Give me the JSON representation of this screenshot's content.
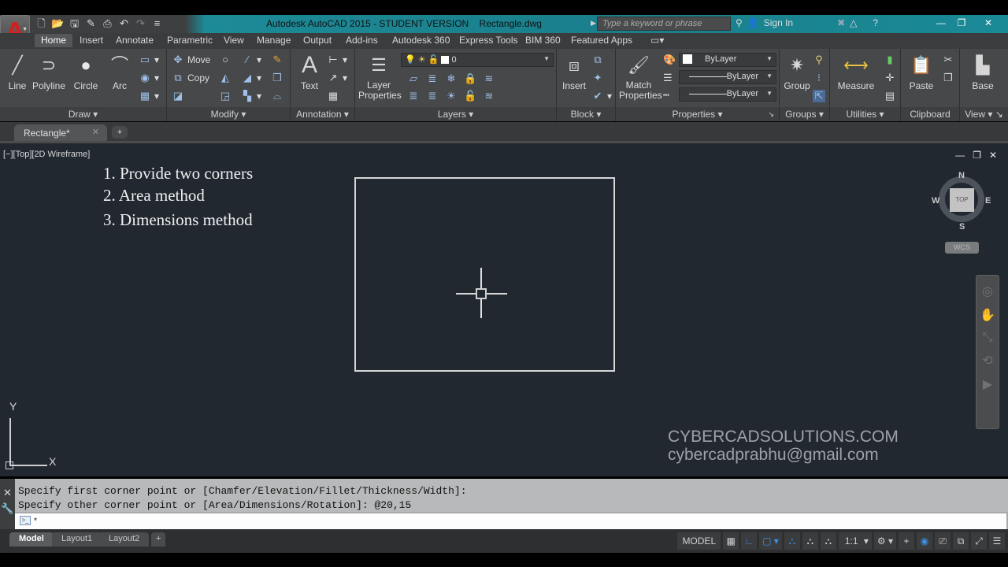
{
  "titlebar": {
    "title": "Autodesk AutoCAD 2015 - STUDENT VERSION    Rectangle.dwg",
    "search_placeholder": "Type a keyword or phrase",
    "sign_in": "Sign In",
    "quick_access": [
      "new-icon",
      "open-icon",
      "save-icon",
      "save-as-icon",
      "plot-icon",
      "undo-icon",
      "redo-icon",
      "customize-icon"
    ]
  },
  "ribbon_tabs": [
    "Home",
    "Insert",
    "Annotate",
    "Parametric",
    "View",
    "Manage",
    "Output",
    "Add-ins",
    "Autodesk 360",
    "Express Tools",
    "BIM 360",
    "Featured Apps"
  ],
  "ribbon": {
    "draw": {
      "title": "Draw",
      "tools": [
        "Line",
        "Polyline",
        "Circle",
        "Arc"
      ]
    },
    "modify": {
      "title": "Modify",
      "move": "Move",
      "copy": "Copy"
    },
    "annotation": {
      "title": "Annotation",
      "text": "Text"
    },
    "layers": {
      "title": "Layers",
      "layer_properties": "Layer\nProperties",
      "current_layer": "0"
    },
    "block": {
      "title": "Block",
      "insert": "Insert"
    },
    "properties": {
      "title": "Properties",
      "match": "Match\nProperties",
      "color": "ByLayer",
      "linetype": "ByLayer",
      "lineweight": "ByLayer"
    },
    "groups": {
      "title": "Groups",
      "group": "Group"
    },
    "utilities": {
      "title": "Utilities",
      "measure": "Measure"
    },
    "clipboard": {
      "title": "Clipboard",
      "paste": "Paste"
    },
    "view": {
      "title": "View",
      "base": "Base"
    }
  },
  "file_tabs": [
    {
      "label": "Rectangle*"
    }
  ],
  "viewport": {
    "label": "[−][Top][2D Wireframe]",
    "instructions": [
      "1. Provide two corners",
      "2. Area method",
      "3. Dimensions method"
    ],
    "viewcube": {
      "face": "TOP",
      "n": "N",
      "s": "S",
      "e": "E",
      "w": "W",
      "wcs": "WCS"
    },
    "ucs": {
      "x": "X",
      "y": "Y"
    },
    "watermark": [
      "CYBERCADSOLUTIONS.COM",
      "cybercadprabhu@gmail.com"
    ]
  },
  "command": {
    "history": [
      "Specify first corner point or [Chamfer/Elevation/Fillet/Thickness/Width]:",
      "Specify other corner point or [Area/Dimensions/Rotation]: @20,15"
    ],
    "input": ""
  },
  "statusbar": {
    "layouts": [
      "Model",
      "Layout1",
      "Layout2"
    ],
    "model": "MODEL",
    "scale": "1:1"
  }
}
